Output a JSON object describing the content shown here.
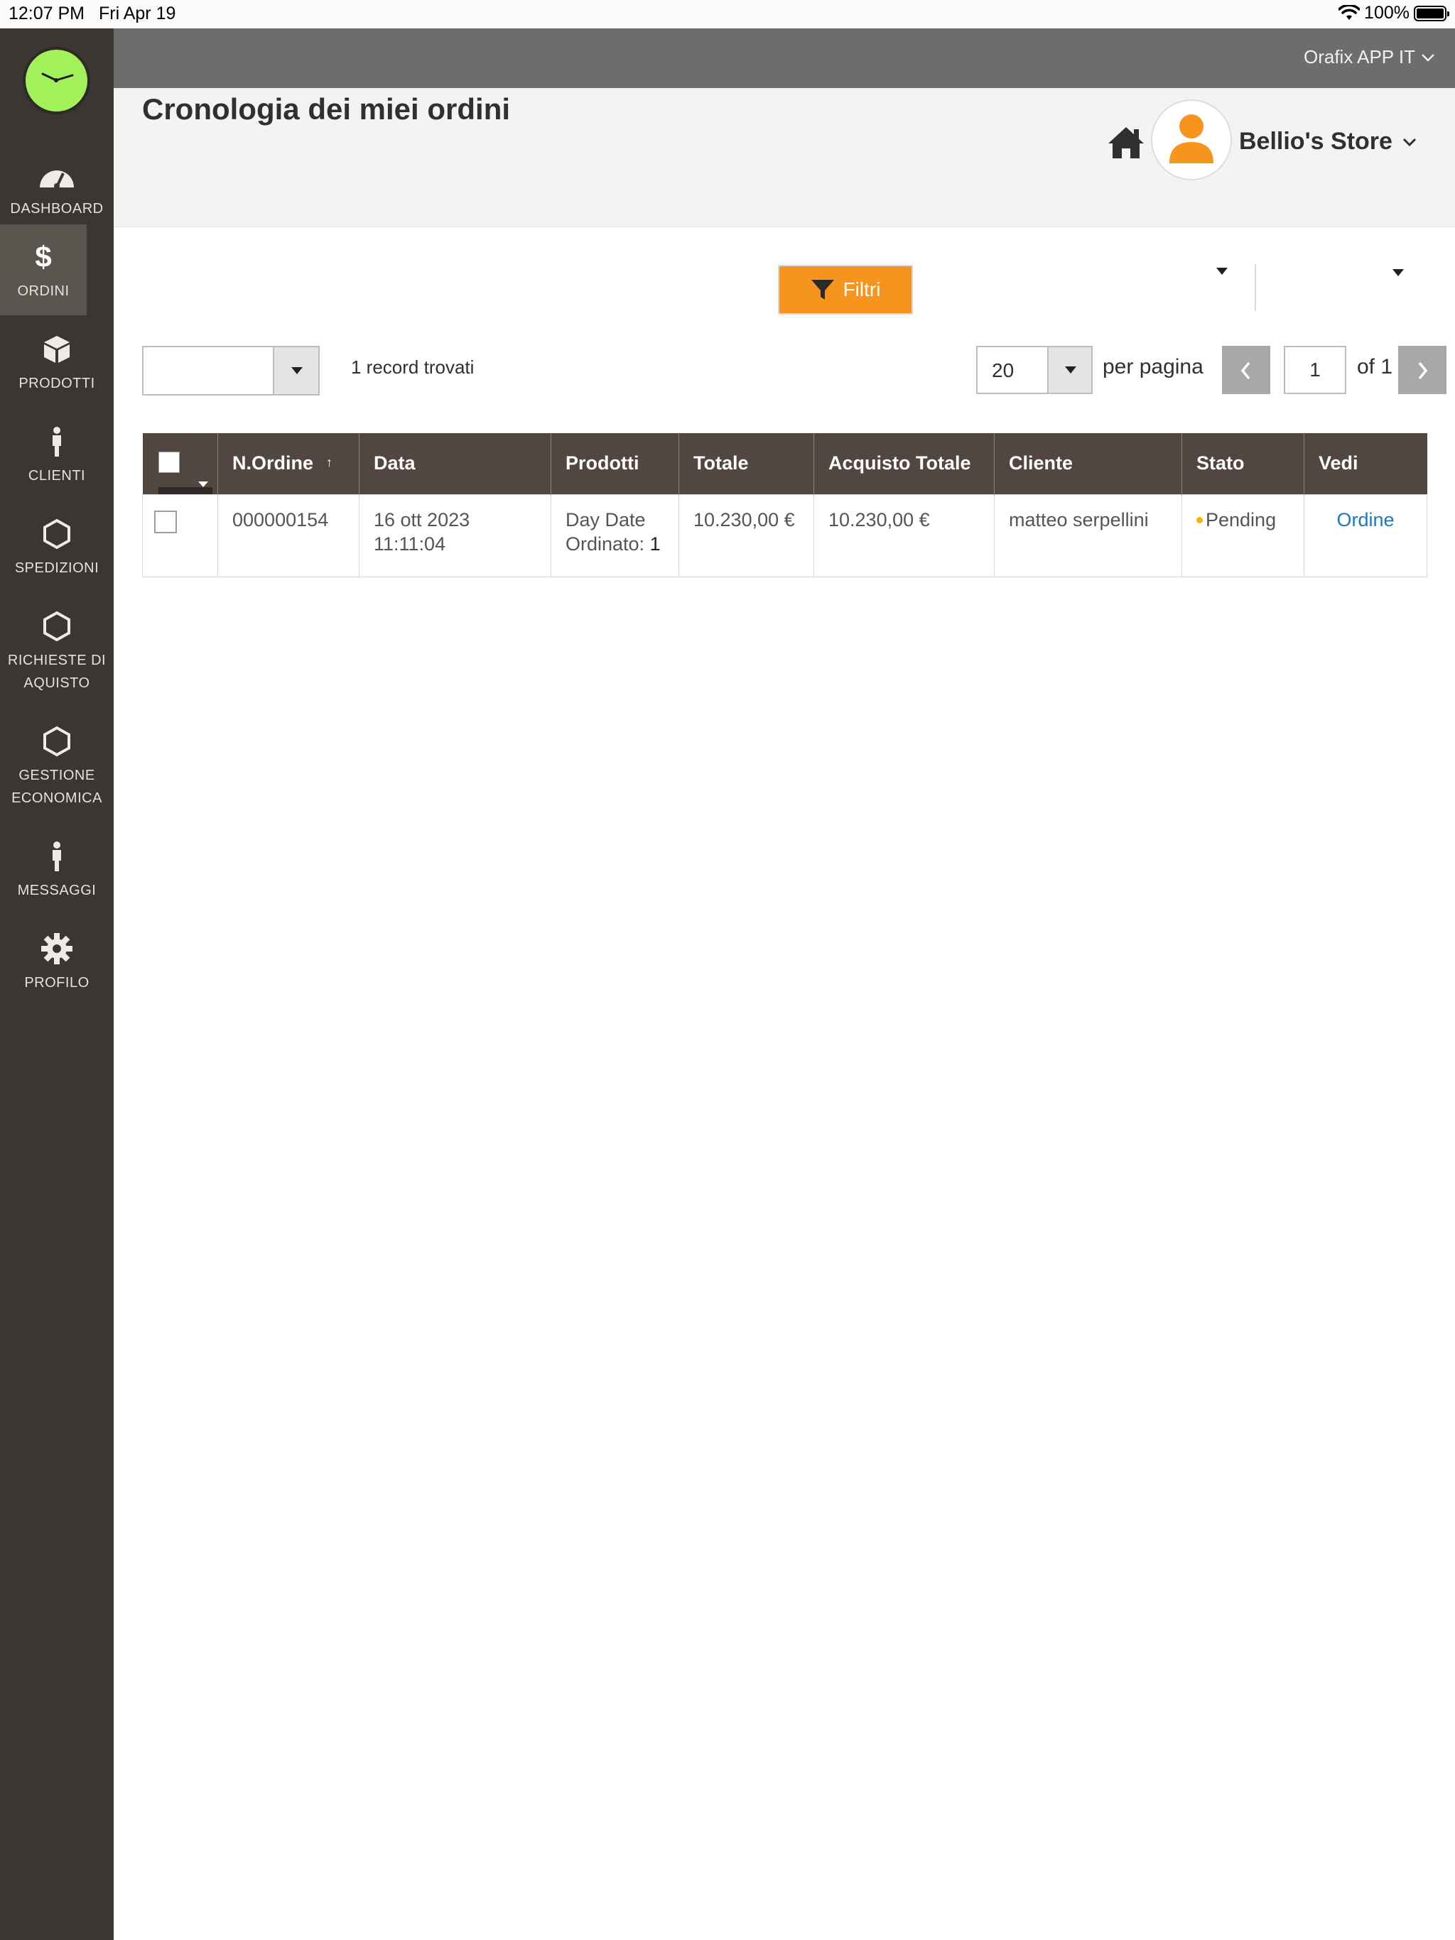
{
  "status_bar": {
    "time": "12:07 PM",
    "date": "Fri Apr 19",
    "battery": "100%"
  },
  "colors": {
    "sidebar_bg": "#3c3632",
    "accent_orange": "#f7941d",
    "logo_green": "#a3f15a",
    "table_header": "#514640",
    "link_blue": "#1979c3",
    "pending_dot": "#f7b500"
  },
  "sidebar": {
    "items": [
      {
        "label": "DASHBOARD",
        "icon": "speedometer-icon"
      },
      {
        "label": "ORDINI",
        "icon": "dollar-icon",
        "active": true
      },
      {
        "label": "PRODOTTI",
        "icon": "box-icon"
      },
      {
        "label": "CLIENTI",
        "icon": "person-icon"
      },
      {
        "label": "SPEDIZIONI",
        "icon": "hexagon-icon"
      },
      {
        "label": "RICHIESTE DI AQUISTO",
        "icon": "hexagon-icon"
      },
      {
        "label": "GESTIONE ECONOMICA",
        "icon": "hexagon-icon"
      },
      {
        "label": "MESSAGGI",
        "icon": "person-icon"
      },
      {
        "label": "PROFILO",
        "icon": "gear-icon"
      }
    ]
  },
  "topbar": {
    "app_switcher": "Orafix APP IT"
  },
  "header": {
    "title": "Cronologia dei miei ordini",
    "store_name": "Bellio's Store"
  },
  "toolbar": {
    "filter_label": "Filtri",
    "records_found": "1 record trovati",
    "per_page_value": "20",
    "per_page_label": "per pagina",
    "current_page": "1",
    "page_of": "of 1"
  },
  "table": {
    "columns": [
      "N.Ordine",
      "Data",
      "Prodotti",
      "Totale",
      "Acquisto Totale",
      "Cliente",
      "Stato",
      "Vedi"
    ],
    "rows": [
      {
        "order_id": "000000154",
        "date": "16 ott 2023 11:11:04",
        "product_name": "Day Date",
        "product_ordered_label": "Ordinato:",
        "product_ordered_qty": "1",
        "total": "10.230,00 €",
        "purchase_total": "10.230,00 €",
        "customer": "matteo serpellini",
        "status": "Pending",
        "view_link": "Ordine"
      }
    ]
  }
}
